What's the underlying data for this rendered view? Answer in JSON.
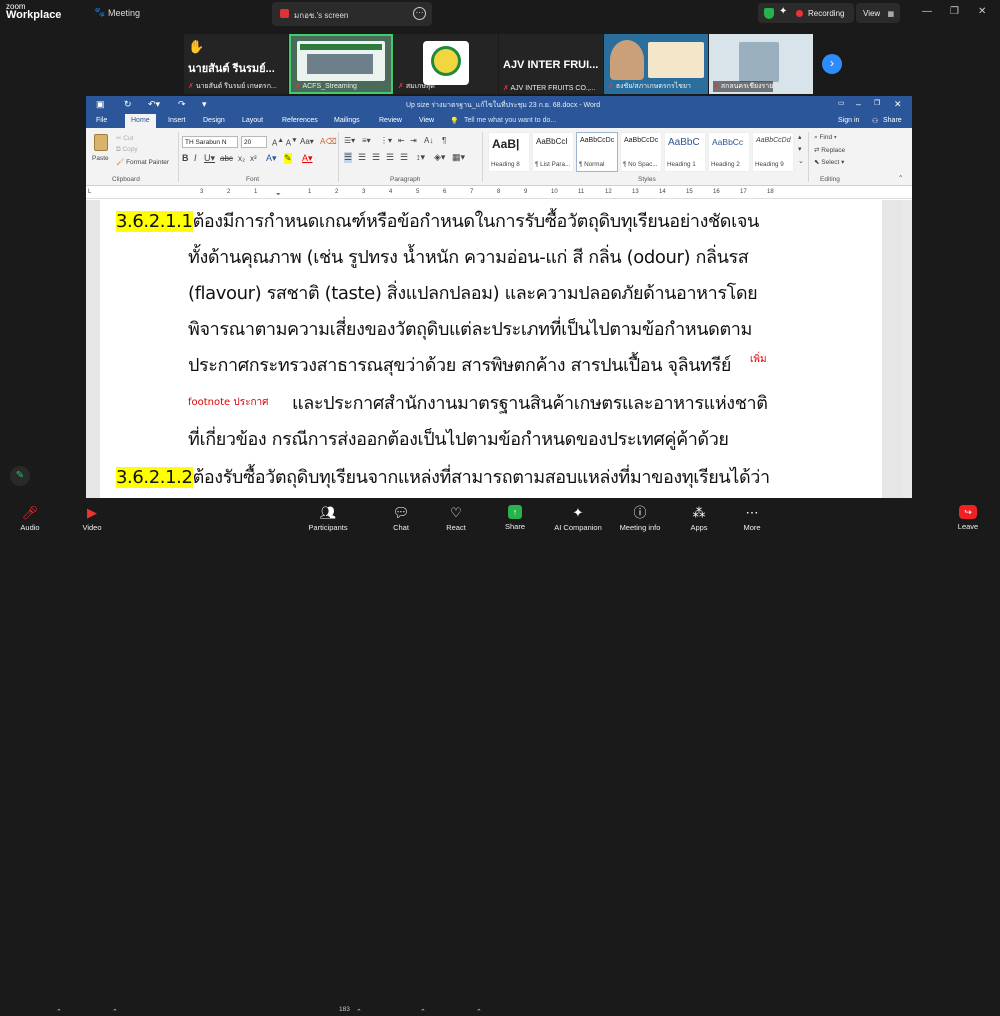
{
  "zoom": {
    "logo_top": "zoom",
    "logo_bottom": "Workplace",
    "meeting_label": "Meeting",
    "share_tab_label": "มกอช.'s screen",
    "recording_label": "Recording",
    "view_label": "View"
  },
  "participants": [
    {
      "name": "นายสันต์ รีนรมย์ เกษตรก...",
      "big_label": "นายสันต์ รีนรมย์..."
    },
    {
      "name": "ACFS_Streaming"
    },
    {
      "name": "สมเกษสุด"
    },
    {
      "name": "AJV INTER FRUITS CO.,...",
      "big_label": "AJV INTER FRUI..."
    },
    {
      "name": "ธงชัย/สภาเกษตรกรไชยา"
    },
    {
      "name": "สกลนครเชียงราย"
    }
  ],
  "word": {
    "doc_title": "Up size ร่างมาตรฐาน_แก้ไขในที่ประชุม 23 ก.ย. 68.docx - Word",
    "tabs": [
      "File",
      "Home",
      "Insert",
      "Design",
      "Layout",
      "References",
      "Mailings",
      "Review",
      "View"
    ],
    "tell_me": "Tell me what you want to do...",
    "sign_in": "Sign in",
    "share": "Share",
    "clipboard": {
      "paste": "Paste",
      "cut": "Cut",
      "copy": "Copy",
      "format_painter": "Format Painter",
      "group": "Clipboard"
    },
    "font": {
      "name": "TH Sarabun N",
      "size": "20",
      "group": "Font"
    },
    "paragraph_group": "Paragraph",
    "styles": [
      {
        "preview": "AaB|",
        "name": "Heading 8"
      },
      {
        "preview": "AaBbCcI",
        "name": "¶ List Para..."
      },
      {
        "preview": "AaBbCcDc",
        "name": "¶ Normal"
      },
      {
        "preview": "AaBbCcDc",
        "name": "¶ No Spac..."
      },
      {
        "preview": "AaBbC",
        "name": "Heading 1"
      },
      {
        "preview": "AaBbCc",
        "name": "Heading 2"
      },
      {
        "preview": "AaBbCcDd",
        "name": "Heading 9"
      }
    ],
    "styles_group": "Styles",
    "editing": {
      "find": "Find",
      "replace": "Replace",
      "select": "Select",
      "group": "Editing"
    },
    "ruler_numbers": [
      "3",
      "2",
      "1",
      "1",
      "2",
      "3",
      "4",
      "5",
      "6",
      "7",
      "8",
      "9",
      "10",
      "11",
      "12",
      "13",
      "14",
      "15",
      "16",
      "17",
      "18"
    ]
  },
  "document": {
    "clause1_number": "3.6.2.1.1",
    "clause1_line1": "ต้องมีการกำหนดเกณฑ์หรือข้อกำหนดในการรับซื้อวัตถุดิบทุเรียนอย่างชัดเจน",
    "line2": "ทั้งด้านคุณภาพ (เช่น รูปทรง น้ำหนัก ความอ่อน-แก่ สี กลิ่น (odour) กลิ่นรส",
    "line3": "(flavour) รสชาติ (taste) สิ่งแปลกปลอม) และความปลอดภัยด้านอาหารโดย",
    "line4": "พิจารณาตามความเสี่ยงของวัตถุดิบแต่ละประเภทที่เป็นไปตามข้อกำหนดตาม",
    "line5": "ประกาศกระทรวงสาธารณสุขว่าด้วย สารพิษตกค้าง สารปนเปื้อน จุลินทรีย์",
    "annotation1": "เพิ่ม",
    "annotation2": "footnote ประกาศ",
    "line6": "และประกาศสำนักงานมาตรฐานสินค้าเกษตรและอาหารแห่งชาติ",
    "line7": "ที่เกี่ยวข้อง กรณีการส่งออกต้องเป็นไปตามข้อกำหนดของประเทศคู่ค้าด้วย",
    "clause2_number": "3.6.2.1.2",
    "clause2_line1": "ต้องรับซื้อวัตถุดิบทุเรียนจากแหล่งที่สามารถตามสอบแหล่งที่มาของทุเรียนได้ว่า"
  },
  "toolbar": {
    "audio": "Audio",
    "video": "Video",
    "participants": "Participants",
    "participant_count": "183",
    "chat": "Chat",
    "react": "React",
    "share": "Share",
    "ai_companion": "AI Companion",
    "meeting_info": "Meeting info",
    "apps": "Apps",
    "more": "More",
    "leave": "Leave"
  },
  "colors": {
    "word_blue": "#2b579a",
    "highlight": "#ffff00",
    "annotation_red": "#e00000",
    "share_green": "#27b24a",
    "leave_red": "#e22222"
  }
}
